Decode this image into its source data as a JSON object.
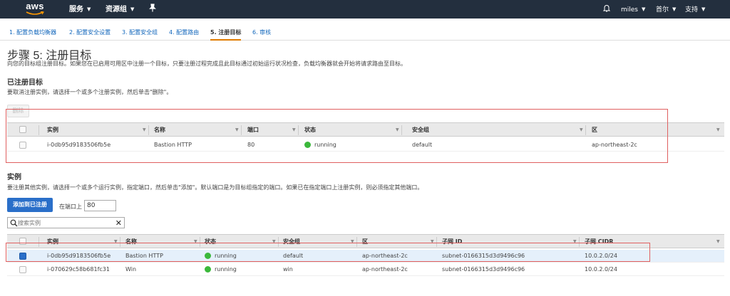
{
  "topnav": {
    "logo": "aws",
    "services": "服务",
    "resource_groups": "资源组",
    "user": "miles",
    "region": "首尔",
    "support": "支持"
  },
  "steps": [
    {
      "label": "1. 配置负载均衡器"
    },
    {
      "label": "2. 配置安全设置"
    },
    {
      "label": "3. 配置安全组"
    },
    {
      "label": "4. 配置路由"
    },
    {
      "label": "5. 注册目标"
    },
    {
      "label": "6. 审核"
    }
  ],
  "page": {
    "title": "步骤 5: 注册目标",
    "description": "向您的目标组注册目标。如果您在已启用可用区中注册一个目标，只要注册过程完成且此目标通过初始运行状况检查，负载均衡器就会开始将请求路由至目标。"
  },
  "registered": {
    "heading": "已注册目标",
    "description": "要取消注册实例，请选择一个或多个注册实例，然后单击\"删除\"。",
    "remove_label": "删除",
    "columns": [
      "实例",
      "名称",
      "端口",
      "状态",
      "安全组",
      "区"
    ],
    "rows": [
      {
        "instance": "i-0db95d9183506fb5e",
        "name": "Bastion HTTP",
        "port": "80",
        "status": "running",
        "sg": "default",
        "zone": "ap-northeast-2c"
      }
    ]
  },
  "instances": {
    "heading": "实例",
    "description": "要注册其他实例，请选择一个或多个运行实例，指定端口，然后单击\"添加\"。默认端口是为目标组指定的端口。如果已在指定端口上注册实例，则必须指定其他端口。",
    "add_label": "添加到已注册",
    "port_label": "在端口上",
    "port_value": "80",
    "search_placeholder": "搜索实例",
    "columns": [
      "实例",
      "名称",
      "状态",
      "安全组",
      "区",
      "子网 ID",
      "子网 CIDR"
    ],
    "rows": [
      {
        "instance": "i-0db95d9183506fb5e",
        "name": "Bastion HTTP",
        "status": "running",
        "sg": "default",
        "zone": "ap-northeast-2c",
        "subnet": "subnet-0166315d3d9496c96",
        "cidr": "10.0.2.0/24",
        "selected": true
      },
      {
        "instance": "i-070629c58b681fc31",
        "name": "Win",
        "status": "running",
        "sg": "win",
        "zone": "ap-northeast-2c",
        "subnet": "subnet-0166315d3d9496c96",
        "cidr": "10.0.2.0/24",
        "selected": false
      }
    ]
  },
  "colors": {
    "nav_bg": "#232f3e",
    "link": "#1166bb",
    "primary": "#2a6fc9",
    "running": "#3bb83b",
    "highlight_border": "#e06060"
  }
}
